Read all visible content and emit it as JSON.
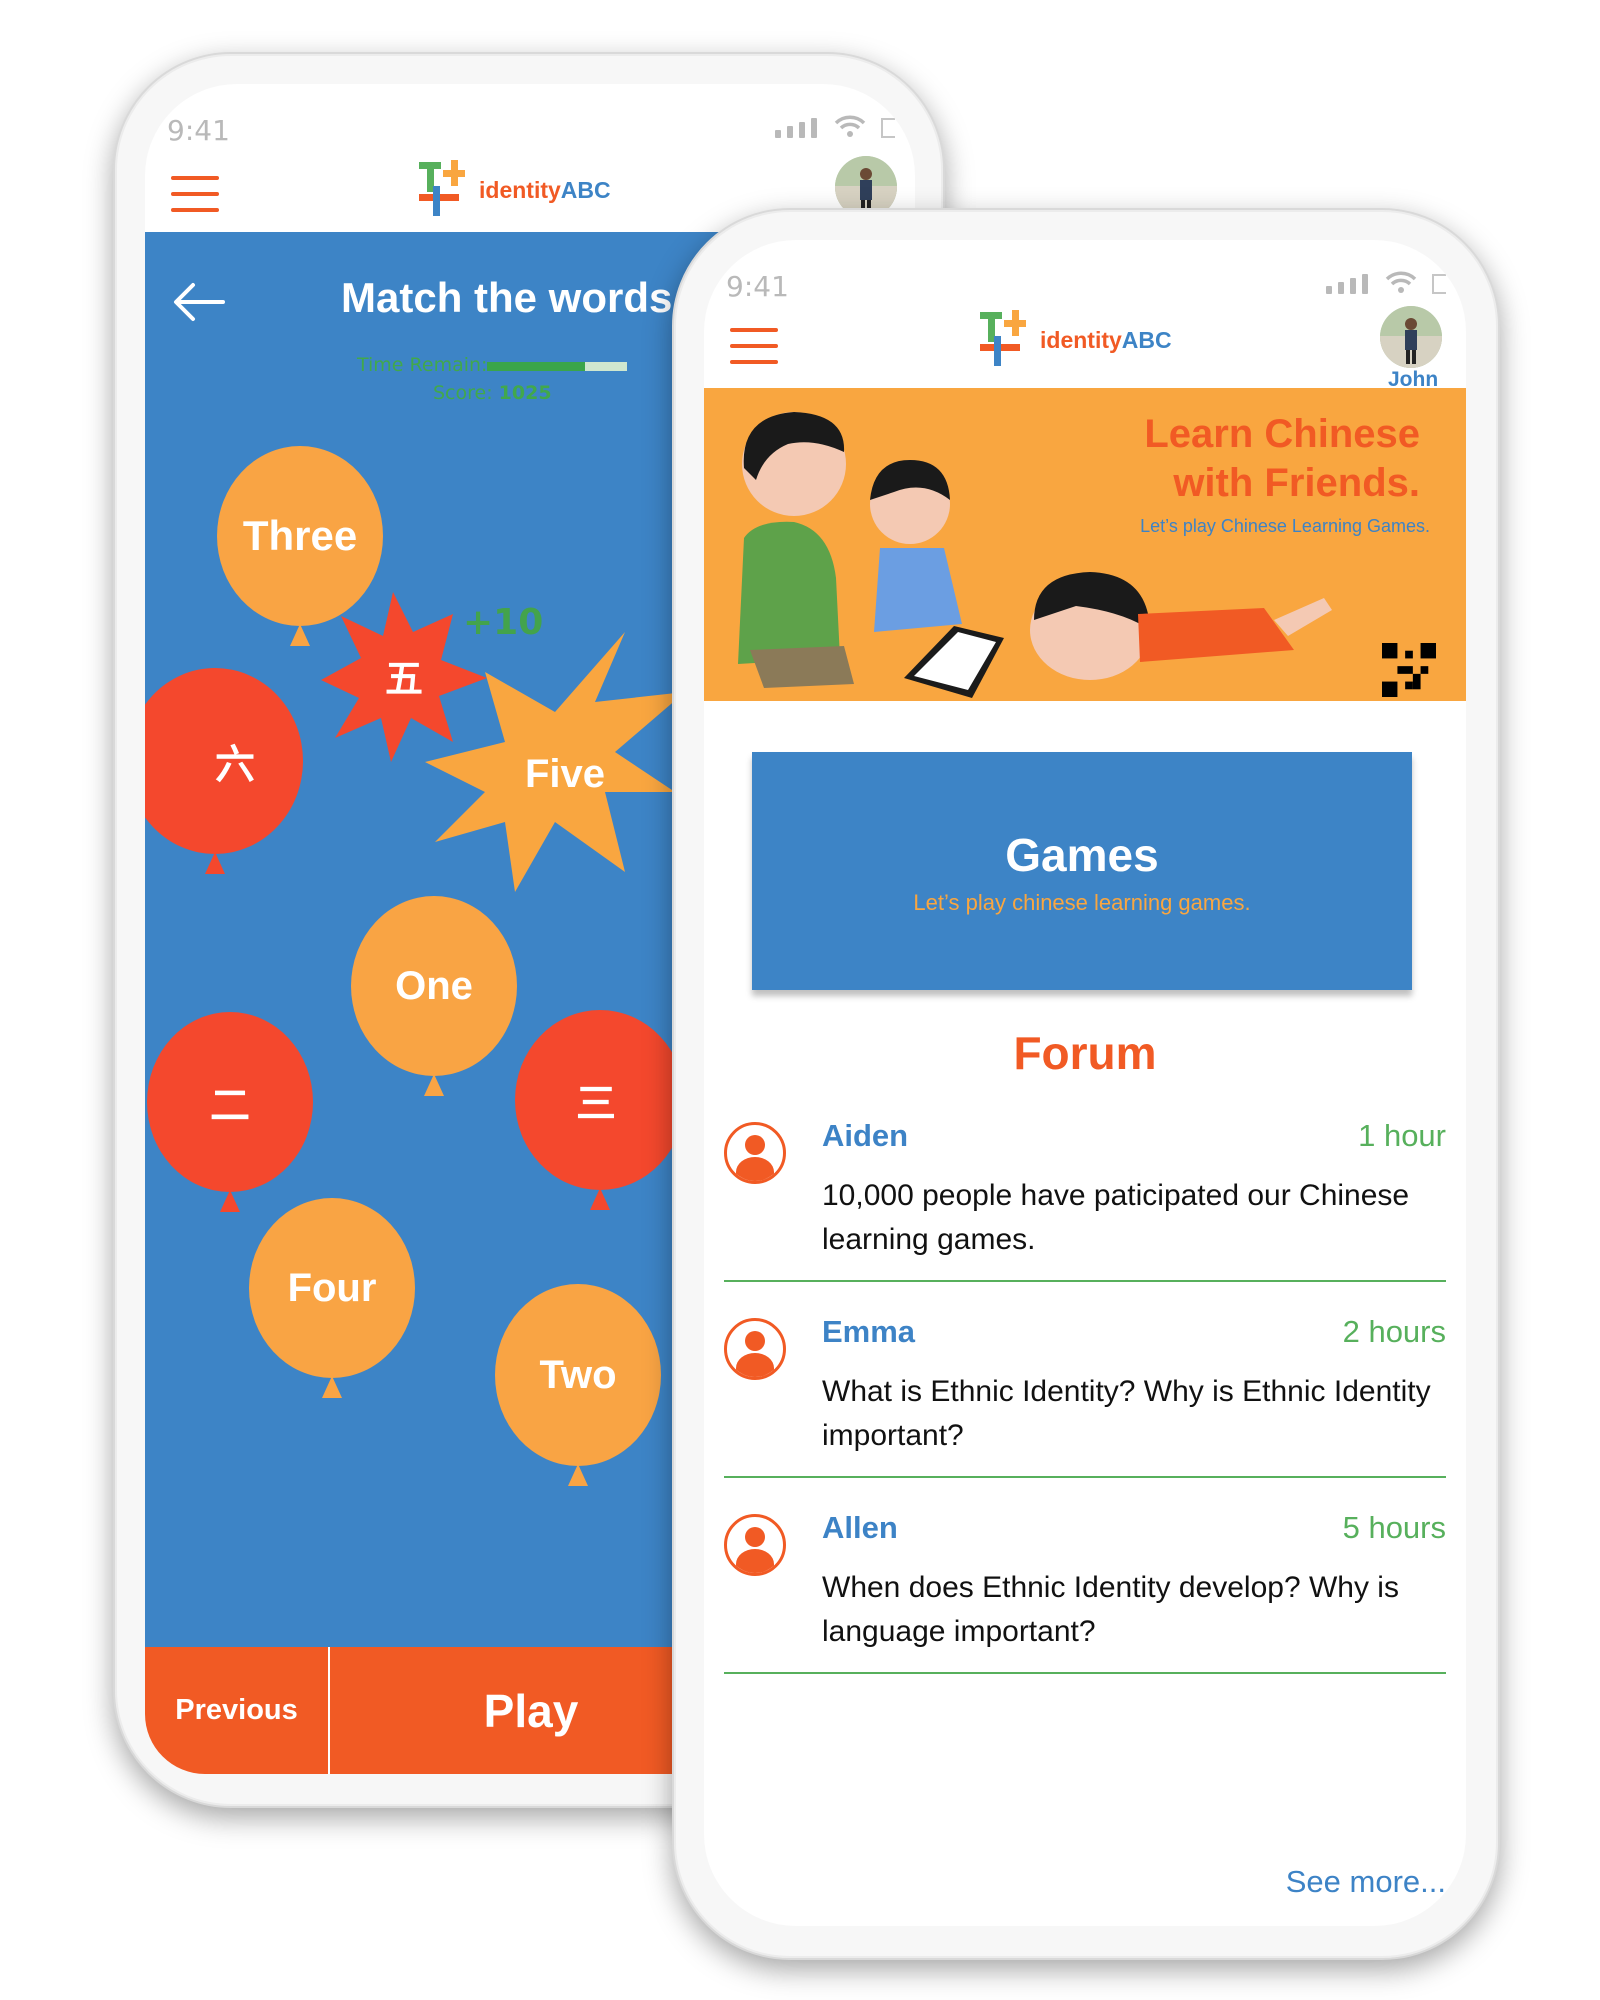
{
  "colors": {
    "brand_orange": "#f15a24",
    "brand_blue": "#3d84c6",
    "accent_yellow": "#f9a640",
    "accent_green": "#57b05c",
    "balloon_red": "#f4482d"
  },
  "status_bar": {
    "time": "9:41",
    "icons": [
      "signal-icon",
      "wifi-icon",
      "battery-icon"
    ]
  },
  "app": {
    "logo_text": "identity",
    "logo_text_abc": "ABC",
    "user_name": "John"
  },
  "game_screen": {
    "title": "Match the words",
    "time_label": "Time Remain:",
    "time_remaining_fraction": 0.7,
    "score_label": "Score:",
    "score_value": "1025",
    "bonus": "+10",
    "balloons": [
      {
        "label": "Three",
        "color": "orange"
      },
      {
        "label": "五",
        "color": "red"
      },
      {
        "label": "Five",
        "color": "orange"
      },
      {
        "label": "六",
        "color": "red"
      },
      {
        "label": "One",
        "color": "orange"
      },
      {
        "label": "二",
        "color": "red"
      },
      {
        "label": "三",
        "color": "red"
      },
      {
        "label": "Four",
        "color": "orange"
      },
      {
        "label": "Two",
        "color": "orange"
      }
    ],
    "previous_label": "Previous",
    "play_label": "Play"
  },
  "home_screen": {
    "banner_title_line1": "Learn Chinese",
    "banner_title_line2": "with Friends.",
    "banner_subtitle": "Let’s play Chinese Learning Games.",
    "games_title": "Games",
    "games_subtitle": "Let’s play chinese learning games.",
    "forum_title": "Forum",
    "posts": [
      {
        "name": "Aiden",
        "time": "1 hour",
        "text": "10,000 people have paticipated our Chinese learning games."
      },
      {
        "name": "Emma",
        "time": "2 hours",
        "text": "What is Ethnic Identity?  Why is Ethnic Identity important?"
      },
      {
        "name": "Allen",
        "time": "5 hours",
        "text": "When does Ethnic Identity develop? Why is language important?"
      }
    ],
    "see_more": "See more..."
  }
}
